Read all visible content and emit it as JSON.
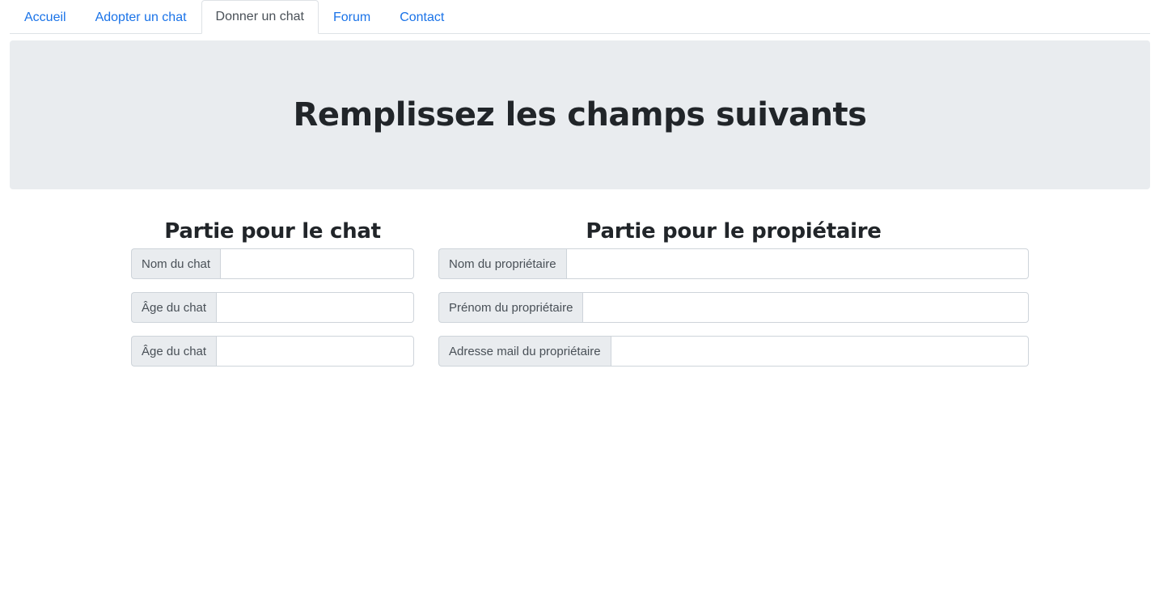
{
  "nav": {
    "tabs": [
      {
        "label": "Accueil",
        "active": false
      },
      {
        "label": "Adopter un chat",
        "active": false
      },
      {
        "label": "Donner un chat",
        "active": true
      },
      {
        "label": "Forum",
        "active": false
      },
      {
        "label": "Contact",
        "active": false
      }
    ]
  },
  "jumbotron": {
    "title": "Remplissez les champs suivants"
  },
  "cat_section": {
    "title": "Partie pour le chat",
    "fields": [
      {
        "label": "Nom du chat",
        "value": ""
      },
      {
        "label": "Âge du chat",
        "value": ""
      },
      {
        "label": "Âge du chat",
        "value": ""
      }
    ]
  },
  "owner_section": {
    "title": "Partie pour le propiétaire",
    "fields": [
      {
        "label": "Nom du propriétaire",
        "value": ""
      },
      {
        "label": "Prénom du propriétaire",
        "value": ""
      },
      {
        "label": "Adresse mail du propriétaire",
        "value": ""
      }
    ]
  },
  "colors": {
    "link": "#1a73e8",
    "jumbotron_bg": "#e9ecef",
    "addon_bg": "#e9ecef",
    "border": "#ced4da"
  }
}
